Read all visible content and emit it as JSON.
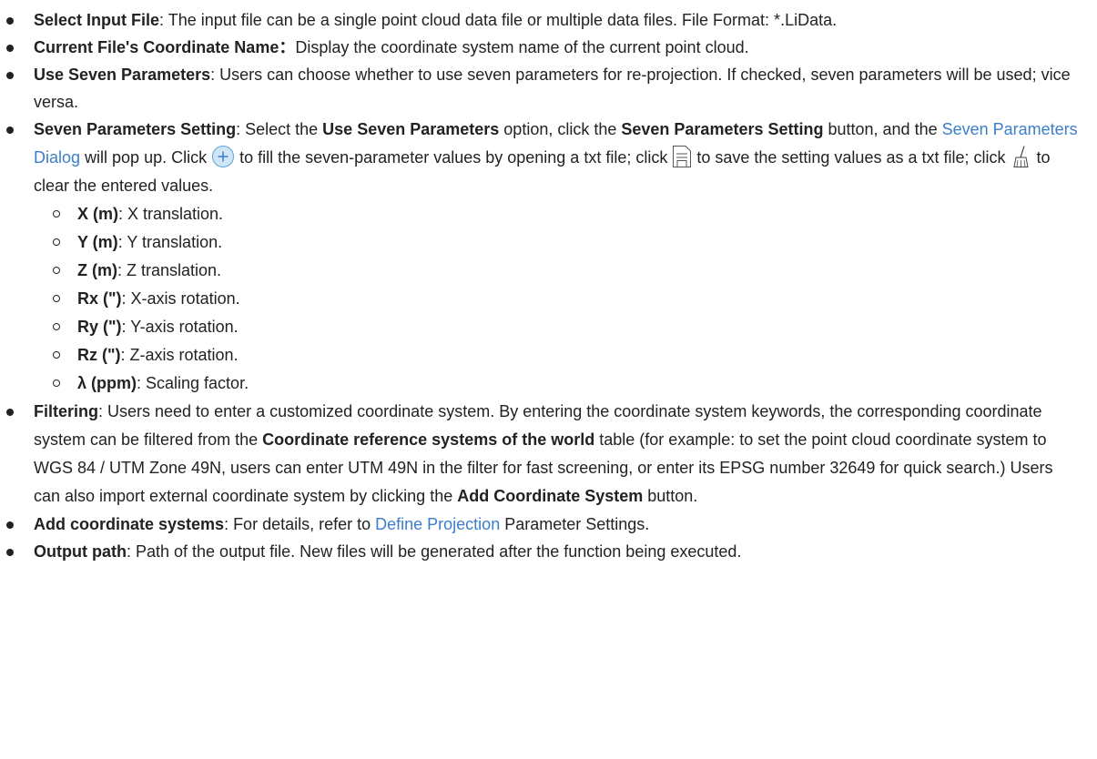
{
  "items": [
    {
      "term": "Select Input File",
      "text": ": The input file can be a single point cloud data file or multiple data files. File Format: *.LiData."
    },
    {
      "term": "Current File's Coordinate Name：",
      "text": "Display the coordinate system name of the current point cloud."
    },
    {
      "term": "Use Seven Parameters",
      "text": ": Users can choose whether to use seven parameters for re-projection. If checked, seven parameters will be used; vice versa."
    },
    {
      "term": "Seven Parameters Setting",
      "t1": ": Select the ",
      "b1": "Use Seven Parameters",
      "t2": " option, click the ",
      "b2": "Seven Parameters Setting",
      "t3": " button, and the ",
      "link": "Seven Parameters Dialog",
      "t4": " will pop up. Click ",
      "t5": " to fill the seven-parameter values by opening a txt file; click ",
      "t6": " to save the setting values as a txt file; click ",
      "t7": " to clear the entered values.",
      "icons": [
        "plus-circle-icon",
        "save-file-icon",
        "broom-icon"
      ]
    },
    {
      "term": "Filtering",
      "t1": ": Users need to enter a customized coordinate system. By entering the coordinate system keywords, the corresponding coordinate system can be filtered from the ",
      "b1": "Coordinate reference systems of the world",
      "t2": " table (for example: to set the point cloud coordinate system to WGS 84 / UTM Zone 49N, users can enter UTM 49N in the filter for fast screening, or enter its EPSG number 32649 for quick search.) Users can also import external coordinate system by clicking the ",
      "b2": "Add Coordinate System",
      "t3": " button."
    },
    {
      "term": "Add coordinate systems",
      "t1": ": For details, refer to ",
      "link": "Define Projection",
      "t2": " Parameter Settings."
    },
    {
      "term": "Output path",
      "text": ": Path of the output file. New files will be generated after the function being executed."
    }
  ],
  "sub_items": [
    {
      "term": "X (m)",
      "text": ": X translation."
    },
    {
      "term": "Y (m)",
      "text": ": Y translation."
    },
    {
      "term": "Z (m)",
      "text": ": Z translation."
    },
    {
      "term": "Rx (\")",
      "text": ": X-axis rotation."
    },
    {
      "term": "Ry (\")",
      "text": ": Y-axis rotation."
    },
    {
      "term": "Rz (\")",
      "text": ": Z-axis rotation."
    },
    {
      "term": "λ (ppm)",
      "text": ": Scaling factor."
    }
  ],
  "colors": {
    "text": "#222222",
    "link": "#3b7ec9",
    "icon_plus_fill": "#cfe6f7",
    "icon_plus_stroke": "#5aa0d8"
  }
}
